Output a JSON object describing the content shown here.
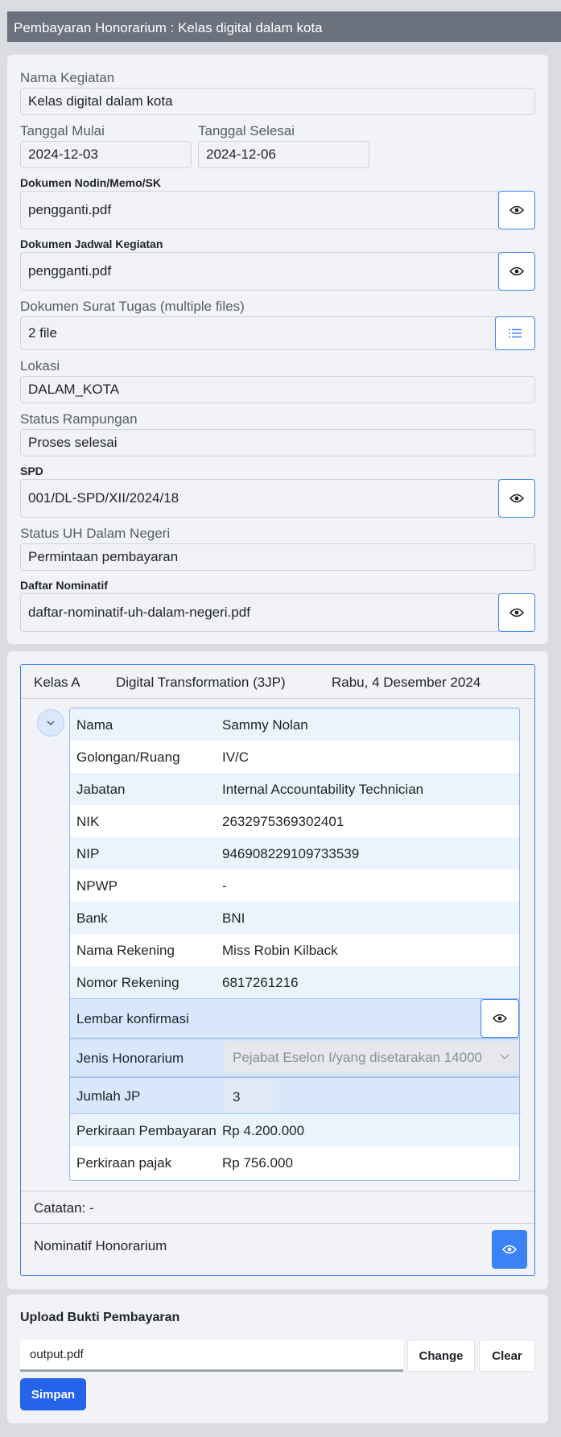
{
  "title": "Pembayaran Honorarium : Kelas digital dalam kota",
  "form": {
    "nama_kegiatan_label": "Nama Kegiatan",
    "nama_kegiatan": "Kelas digital dalam kota",
    "tanggal_mulai_label": "Tanggal Mulai",
    "tanggal_mulai": "2024-12-03",
    "tanggal_selesai_label": "Tanggal Selesai",
    "tanggal_selesai": "2024-12-06",
    "dok_nodin_label": "Dokumen Nodin/Memo/SK",
    "dok_nodin": "pengganti.pdf",
    "dok_jadwal_label": "Dokumen Jadwal Kegiatan",
    "dok_jadwal": "pengganti.pdf",
    "dok_surat_label": "Dokumen Surat Tugas (multiple files)",
    "dok_surat": "2 file",
    "lokasi_label": "Lokasi",
    "lokasi": "DALAM_KOTA",
    "status_rampungan_label": "Status Rampungan",
    "status_rampungan": "Proses selesai",
    "spd_label": "SPD",
    "spd": "001/DL-SPD/XII/2024/18",
    "status_uh_label": "Status UH Dalam Negeri",
    "status_uh": "Permintaan pembayaran",
    "daftar_nominatif_label": "Daftar Nominatif",
    "daftar_nominatif": "daftar-nominatif-uh-dalam-negeri.pdf"
  },
  "session": {
    "kelas": "Kelas A",
    "topik": "Digital Transformation  (3JP)",
    "tanggal": "Rabu, 4 Desember 2024",
    "rows": [
      {
        "k": "Nama",
        "v": "Sammy Nolan"
      },
      {
        "k": "Golongan/Ruang",
        "v": "IV/C"
      },
      {
        "k": "Jabatan",
        "v": "Internal Accountability Technician"
      },
      {
        "k": "NIK",
        "v": "2632975369302401"
      },
      {
        "k": "NIP",
        "v": "946908229109733539"
      },
      {
        "k": "NPWP",
        "v": "-"
      },
      {
        "k": "Bank",
        "v": "BNI"
      },
      {
        "k": "Nama Rekening",
        "v": "Miss Robin Kilback"
      },
      {
        "k": "Nomor Rekening",
        "v": "6817261216"
      }
    ],
    "lembar_label": "Lembar konfirmasi",
    "jenis_label": "Jenis Honorarium",
    "jenis_value": "Pejabat Eselon I/yang disetarakan 14000",
    "jumlah_label": "Jumlah JP",
    "jumlah_value": "3",
    "perkiraan_bayar_label": "Perkiraan Pembayaran",
    "perkiraan_bayar": "Rp 4.200.000",
    "perkiraan_pajak_label": "Perkiraan pajak",
    "perkiraan_pajak": "Rp 756.000",
    "catatan": "Catatan: -",
    "nominatif_label": "Nominatif Honorarium"
  },
  "upload": {
    "title": "Upload Bukti Pembayaran",
    "file": "output.pdf",
    "change": "Change",
    "clear": "Clear",
    "save": "Simpan"
  },
  "colors": {
    "accent": "#3b82f6",
    "primary_button": "#2563eb",
    "titlebar": "#6b717d"
  }
}
